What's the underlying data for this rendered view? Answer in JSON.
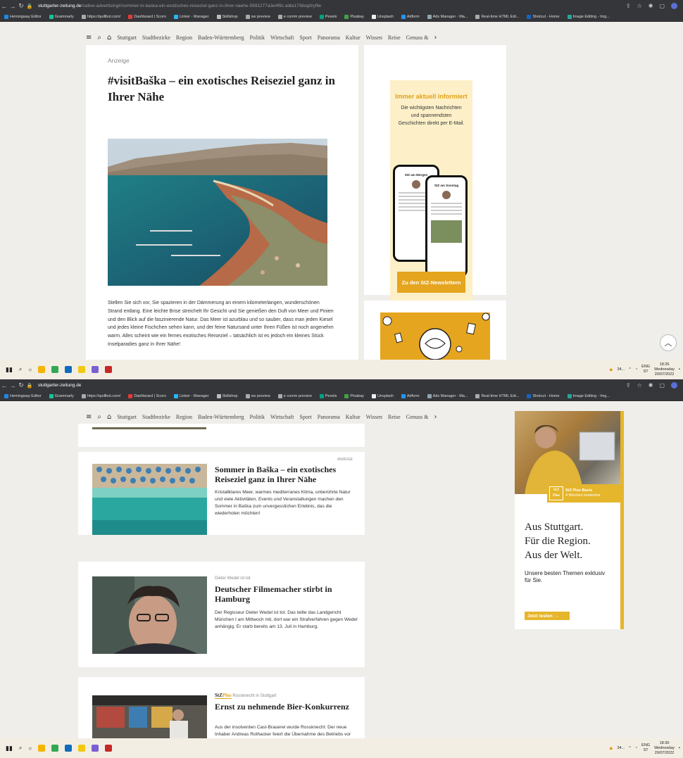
{
  "screen1": {
    "browser": {
      "url_host": "stuttgarter-zeitung.de",
      "url_path": "/native-advertising#/sommer-in-baska-ein-exotisches-reiseziel-ganz-in-ihrer-naehe-5691277a3e4f9c.adta17/blog/tryfile",
      "bookmarks": [
        "Hemingway Editor",
        "Grammarly",
        "https://quillbot.com/",
        "Dashboard | Scoro",
        "Linker - Manager",
        "Skillshop",
        "sw preview",
        "e comm preview",
        "Pexels",
        "Pixabay",
        "Unsplash",
        "Adform",
        "Ads Manager - Ma...",
        "Real-time HTML Edi...",
        "Shotcut - Home",
        "Image Editing - Img..."
      ]
    },
    "nav": [
      "Stuttgart",
      "Stadtbezirke",
      "Region",
      "Baden-Württemberg",
      "Politik",
      "Wirtschaft",
      "Sport",
      "Panorama",
      "Kultur",
      "Wissen",
      "Reise",
      "Genuss &"
    ],
    "article": {
      "label": "Anzeige",
      "title": "#visitBaška – ein exotisches Reiseziel ganz in Ihrer Nähe",
      "body": "Stellen Sie sich vor, Sie spazieren in der Dämmerung an einem kilometerlangen, wunderschönen Strand entlang. Eine leichte Brise streichelt Ihr Gesicht und Sie genießen den Duft von Meer und Pinien und den Blick auf die faszinierende Natur. Das Meer ist azurblau und so sauber, dass man jeden Kiesel und jedes kleine Fischchen sehen kann, und der feine Natursand unter Ihren Füßen ist noch angenehm warm. Alles scheint wie ein fernes exotisches Reiseziel – tatsächlich ist es jedoch ein kleines Stück Inselparadies ganz in Ihrer Nähe!"
    },
    "newsletter": {
      "title": "Immer aktuell informiert",
      "text": "Die wichtigsten Nachrichten und spannendsten Geschichten direkt per E-Mail.",
      "phone_back_title": "StZ am Morgen",
      "phone_front_title": "StZ am Sonntag",
      "button": "Zu den StZ-Newslettern"
    },
    "taskbar": {
      "tray_text": "34...",
      "lang": "ENG",
      "region": "ST",
      "time": "18:26",
      "day": "Wednesday",
      "date": "20/07/2022"
    }
  },
  "screen2": {
    "browser": {
      "url_host": "stuttgarter-zeitung.de"
    },
    "teasers": [
      {
        "kicker": "ANZEIGE",
        "title": "Sommer in Baška – ein exotisches Reiseziel ganz in Ihrer Nähe",
        "text": "Kristallklares Meer, warmes mediterranes Klima, unberührte Natur und viele Aktivitäten, Events und Veranstaltungen machen den Sommer in Baška zum unvergesslichen Erlebnis, das die wiederholen möchten!"
      },
      {
        "kicker": "Dieter Wedel ist tot",
        "title": "Deutscher Filmemacher stirbt in Hamburg",
        "text": "Der Regisseur Dieter Wedel ist tot. Das teilte das Landgericht München I am Mittwoch mit, dort war ein Strafverfahren gegen Wedel anhängig. Er starb bereits am 13. Juli in Hamburg."
      },
      {
        "brand": "StZ",
        "brand_plus": "Plus",
        "kicker": "Rossknecht in Stuttgart",
        "title": "Ernst zu nehmende Bier-Konkurrenz",
        "text": "Aus der insolventen Cast-Brauerei wurde Rossknecht: Der neue Inhaber Andreas Rothacker feiert die Übernahme des Betriebs vor einem Jahr mit einem Fest"
      }
    ],
    "ad": {
      "logo": "StZ Plus",
      "badge_line1": "StZ Plus Basis",
      "badge_line2": "4 Wochen kostenlos",
      "claim1": "Aus Stuttgart.",
      "claim2": "Für die Region.",
      "claim3": "Aus der Welt.",
      "sub": "Unsere besten Themen exklusiv für Sie.",
      "button": "Jetzt testen →"
    },
    "taskbar": {
      "tray_text": "34...",
      "lang": "ENG",
      "region": "ST",
      "time": "18:30",
      "day": "Wednesday",
      "date": "20/07/2022"
    }
  },
  "colors": {
    "accent": "#e5a51e",
    "page_bg": "#efeeea",
    "chrome": "#35363a"
  }
}
